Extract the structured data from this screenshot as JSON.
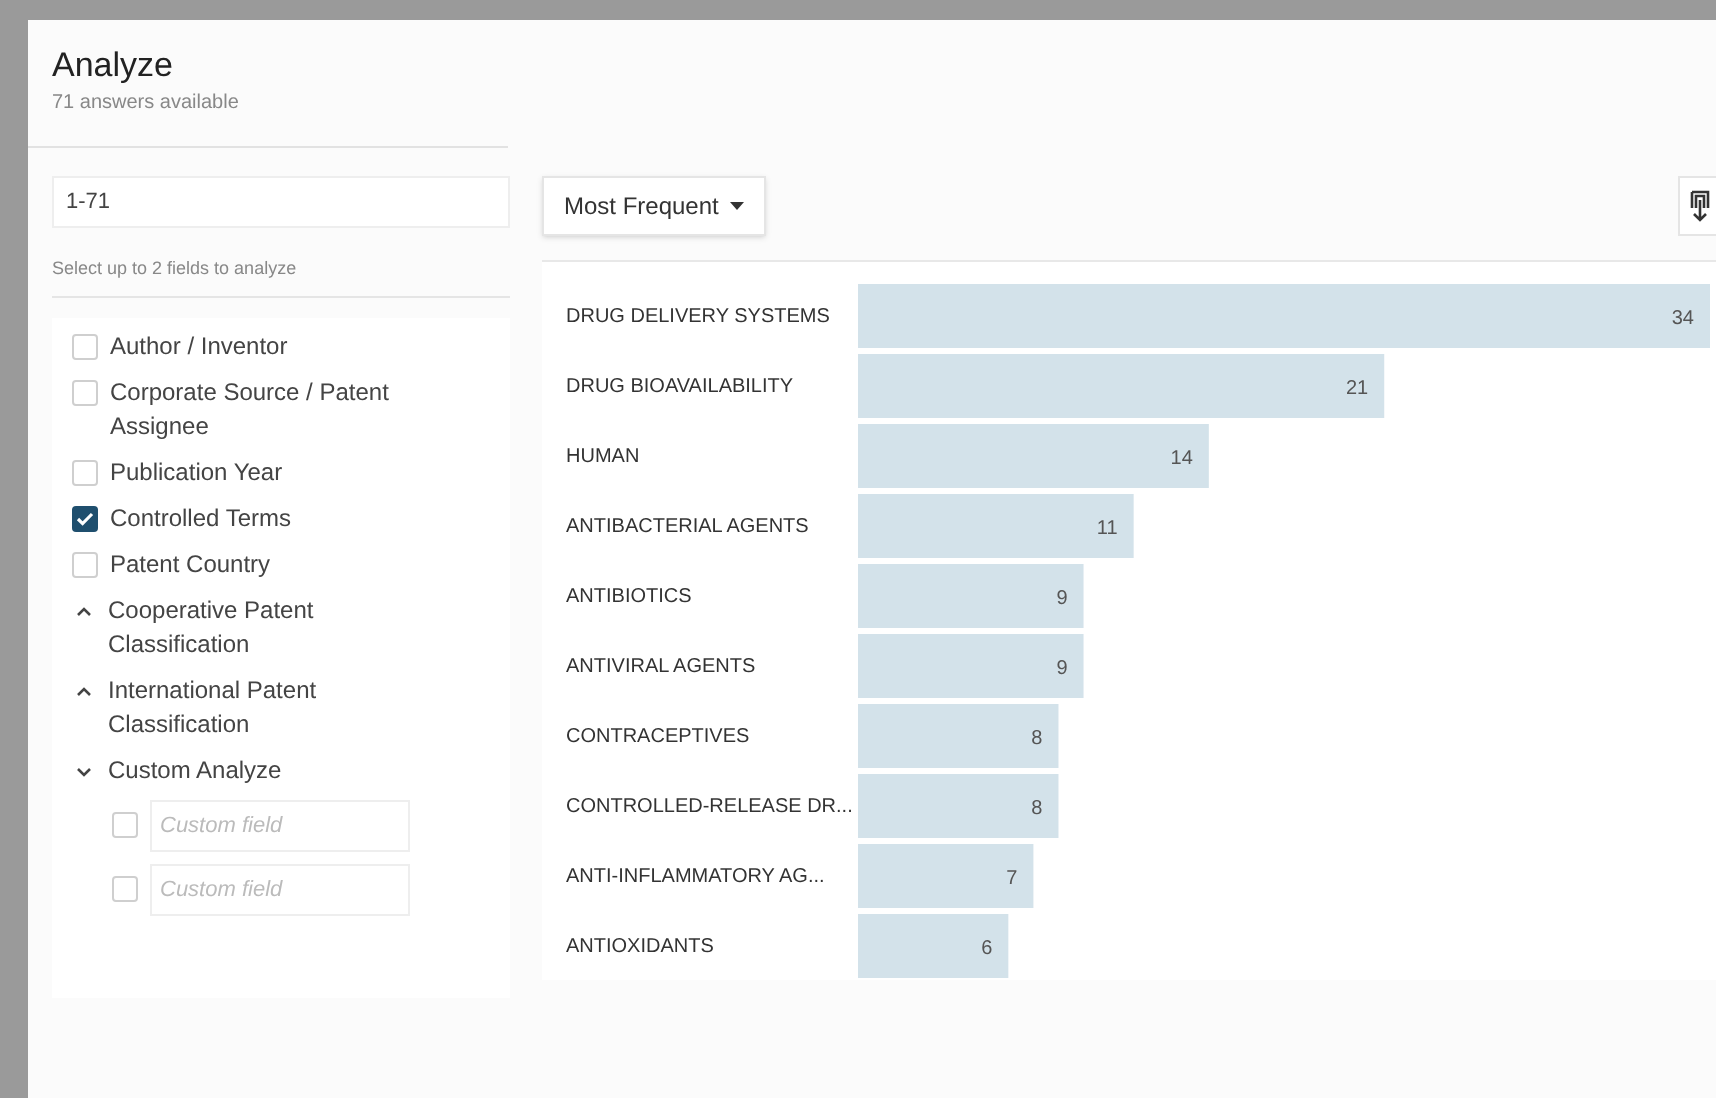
{
  "dialog": {
    "title": "Analyze",
    "subtitle": "71 answers available"
  },
  "range_field": {
    "value": "1-71"
  },
  "fields_hint": "Select up to 2 fields to analyze",
  "fields": [
    {
      "kind": "checkbox",
      "label": "Author / Inventor",
      "checked": false
    },
    {
      "kind": "checkbox",
      "label": "Corporate Source / Patent Assignee",
      "checked": false
    },
    {
      "kind": "checkbox",
      "label": "Publication Year",
      "checked": false
    },
    {
      "kind": "checkbox",
      "label": "Controlled Terms",
      "checked": true
    },
    {
      "kind": "checkbox",
      "label": "Patent Country",
      "checked": false
    },
    {
      "kind": "group",
      "label": "Cooperative Patent Classification",
      "expanded": false
    },
    {
      "kind": "group",
      "label": "International Patent Classification",
      "expanded": false
    },
    {
      "kind": "group",
      "label": "Custom Analyze",
      "expanded": true,
      "children": [
        {
          "placeholder": "Custom field",
          "checked": false
        },
        {
          "placeholder": "Custom field",
          "checked": false
        }
      ]
    }
  ],
  "sort_dropdown": {
    "label": "Most Frequent"
  },
  "chart": {
    "chart_data": {
      "type": "bar",
      "orientation": "horizontal",
      "data_labels": true,
      "categories": [
        "DRUG DELIVERY SYSTEMS",
        "DRUG BIOAVAILABILITY",
        "HUMAN",
        "ANTIBACTERIAL AGENTS",
        "ANTIBIOTICS",
        "ANTIVIRAL AGENTS",
        "CONTRACEPTIVES",
        "CONTROLLED-RELEASE DR...",
        "ANTI-INFLAMMATORY AG...",
        "ANTIOXIDANTS"
      ],
      "series": [
        {
          "color": "#d3e2ea",
          "values": [
            34,
            21,
            14,
            11,
            9,
            9,
            8,
            8,
            7,
            6
          ]
        }
      ]
    }
  }
}
